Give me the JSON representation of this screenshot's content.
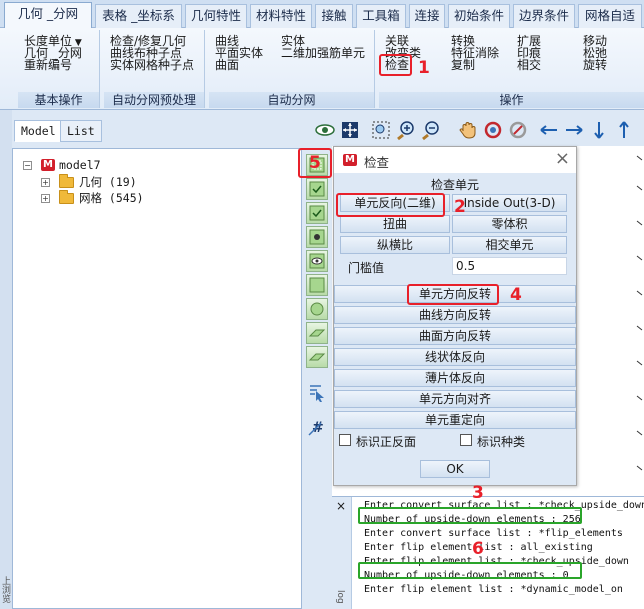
{
  "tabs": [
    "几何 _分网",
    "表格 _坐标系",
    "几何特性",
    "材料特性",
    "接触",
    "工具箱",
    "连接",
    "初始条件",
    "边界条件",
    "网格自适"
  ],
  "ribbon": {
    "groups": {
      "basic": {
        "title": "基本操作",
        "items": [
          "长度单位",
          "几何 _分网",
          "重新编号"
        ]
      },
      "auto_pre": {
        "title": "自动分网预处理",
        "items": [
          "检查/修复几何",
          "曲线布种子点",
          "实体网格种子点"
        ]
      },
      "auto_mesh": {
        "title": "自动分网",
        "items": [
          "曲线",
          "平面实体",
          "曲面",
          "实体",
          "二维加强筋单元"
        ]
      },
      "ops": {
        "title": "操作",
        "items": [
          "关联",
          "改变类",
          "检查",
          "转换",
          "特征消除",
          "复制",
          "扩展",
          "印痕",
          "相交",
          "移动",
          "松弛",
          "旋转"
        ]
      }
    }
  },
  "left_panel": {
    "tabs": [
      "Model",
      "List"
    ],
    "tree": {
      "root": "model7",
      "children": [
        {
          "label": "几何 (19)"
        },
        {
          "label": "网格 (545)"
        }
      ]
    },
    "side_caption": "上浏览"
  },
  "dialog": {
    "title": "检查",
    "section_title": "检查单元",
    "buttons": {
      "flip_2d": "单元反向(二维)",
      "inside_out": "Inside Out(3-D)",
      "distortion": "扭曲",
      "zero_volume": "零体积",
      "aspect_ratio": "纵横比",
      "intersect": "相交单元"
    },
    "threshold_label": "门槛值",
    "threshold_value": "0.5",
    "actions": [
      "单元方向反转",
      "曲线方向反转",
      "曲面方向反转",
      "线状体反向",
      "薄片体反向",
      "单元方向对齐",
      "单元重定向"
    ],
    "checkboxes": [
      "标识正反面",
      "标识种类"
    ],
    "ok": "OK"
  },
  "console": {
    "close": "×",
    "side_caption": "log",
    "lines": [
      "Enter convert surface list : *check_upside_down",
      "Number of upside-down elements : 256",
      "Enter convert surface list : *flip_elements",
      "Enter flip element list : all_existing",
      "Enter flip element list : *check_upside_down",
      "Number of upside-down elements : 0",
      "Enter flip element list : *dynamic_model_on"
    ]
  },
  "annotations": [
    "1",
    "2",
    "3",
    "4",
    "5",
    "6"
  ],
  "colors": {
    "annotation_red": "#e8202a",
    "annotation_green": "#2aa52a",
    "ribbon_bg": "#e2ecf8",
    "brand_red": "#d21f2b"
  }
}
